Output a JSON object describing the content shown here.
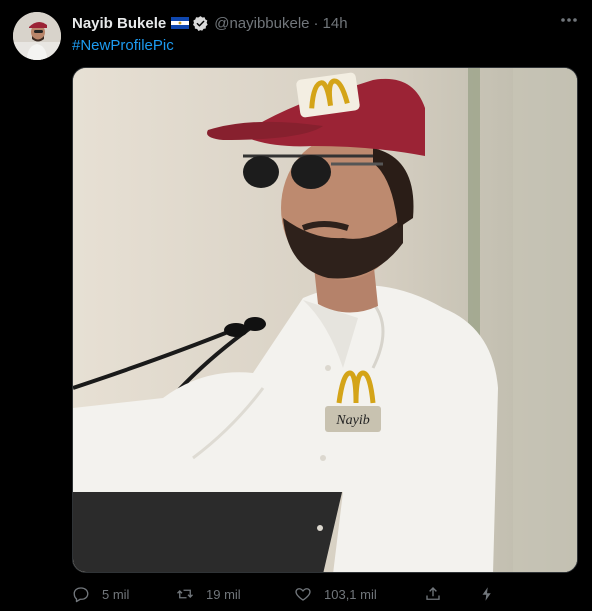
{
  "tweet": {
    "author_name": "Nayib Bukele",
    "handle": "@nayibbukele",
    "separator": "·",
    "time": "14h",
    "text": "#NewProfilePic",
    "badge_text": "Nayib"
  },
  "actions": {
    "reply_count": "5 mil",
    "retweet_count": "19 mil",
    "like_count": "103,1 mil"
  },
  "icons": {
    "more": "more-horizontal-icon",
    "reply": "reply-icon",
    "retweet": "retweet-icon",
    "like": "heart-icon",
    "share": "share-icon",
    "analytics": "lightning-icon"
  },
  "colors": {
    "background": "#000000",
    "link": "#1d9bf0",
    "muted": "#71767b",
    "verified": "#aab8c2",
    "cap": "#9b2335"
  }
}
